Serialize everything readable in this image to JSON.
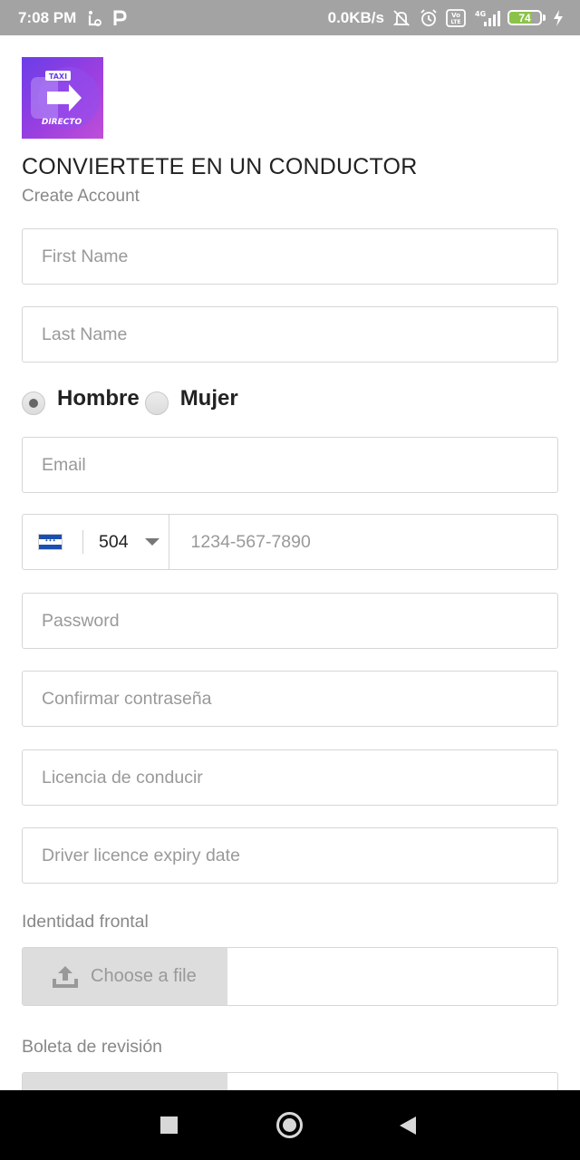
{
  "status_bar": {
    "time": "7:08 PM",
    "network_speed": "0.0KB/s",
    "volte_badge": "Vo LTE",
    "signal_badge": "4G",
    "battery_level": "74",
    "battery_fraction": 0.74,
    "icons": [
      "accessibility-icon",
      "parking-icon",
      "notifications-off-icon",
      "alarm-icon",
      "volte-icon",
      "signal-icon",
      "battery-icon",
      "charging-icon"
    ]
  },
  "header": {
    "logo_text_top": "TAXI",
    "logo_text_bottom": "DIRECTO",
    "title": "CONVIERTETE EN UN CONDUCTOR",
    "subtitle": "Create Account"
  },
  "form": {
    "first_name_placeholder": "First Name",
    "last_name_placeholder": "Last Name",
    "gender": {
      "male_label": "Hombre",
      "female_label": "Mujer",
      "selected": "Hombre"
    },
    "email_placeholder": "Email",
    "phone": {
      "country_code": "504",
      "flag": "honduras-flag",
      "placeholder": "1234-567-7890"
    },
    "password_placeholder": "Password",
    "confirm_password_placeholder": "Confirmar contraseña",
    "license_placeholder": "Licencia de conducir",
    "license_expiry_placeholder": "Driver licence expiry date",
    "id_front_label": "Identidad frontal",
    "choose_file_label": "Choose a file",
    "inspection_label": "Boleta de revisión"
  },
  "colors": {
    "status_bar_bg": "#a3a3a3",
    "logo_gradient_start": "#6a3de8",
    "logo_gradient_end": "#c04fd8",
    "field_border": "#d6d6d6",
    "placeholder_text": "#999999",
    "file_button_bg": "#dddddd",
    "nav_bar_bg": "#000000"
  },
  "nav_bar": {
    "icons": [
      "recents-square-icon",
      "home-circle-icon",
      "back-triangle-icon"
    ]
  }
}
